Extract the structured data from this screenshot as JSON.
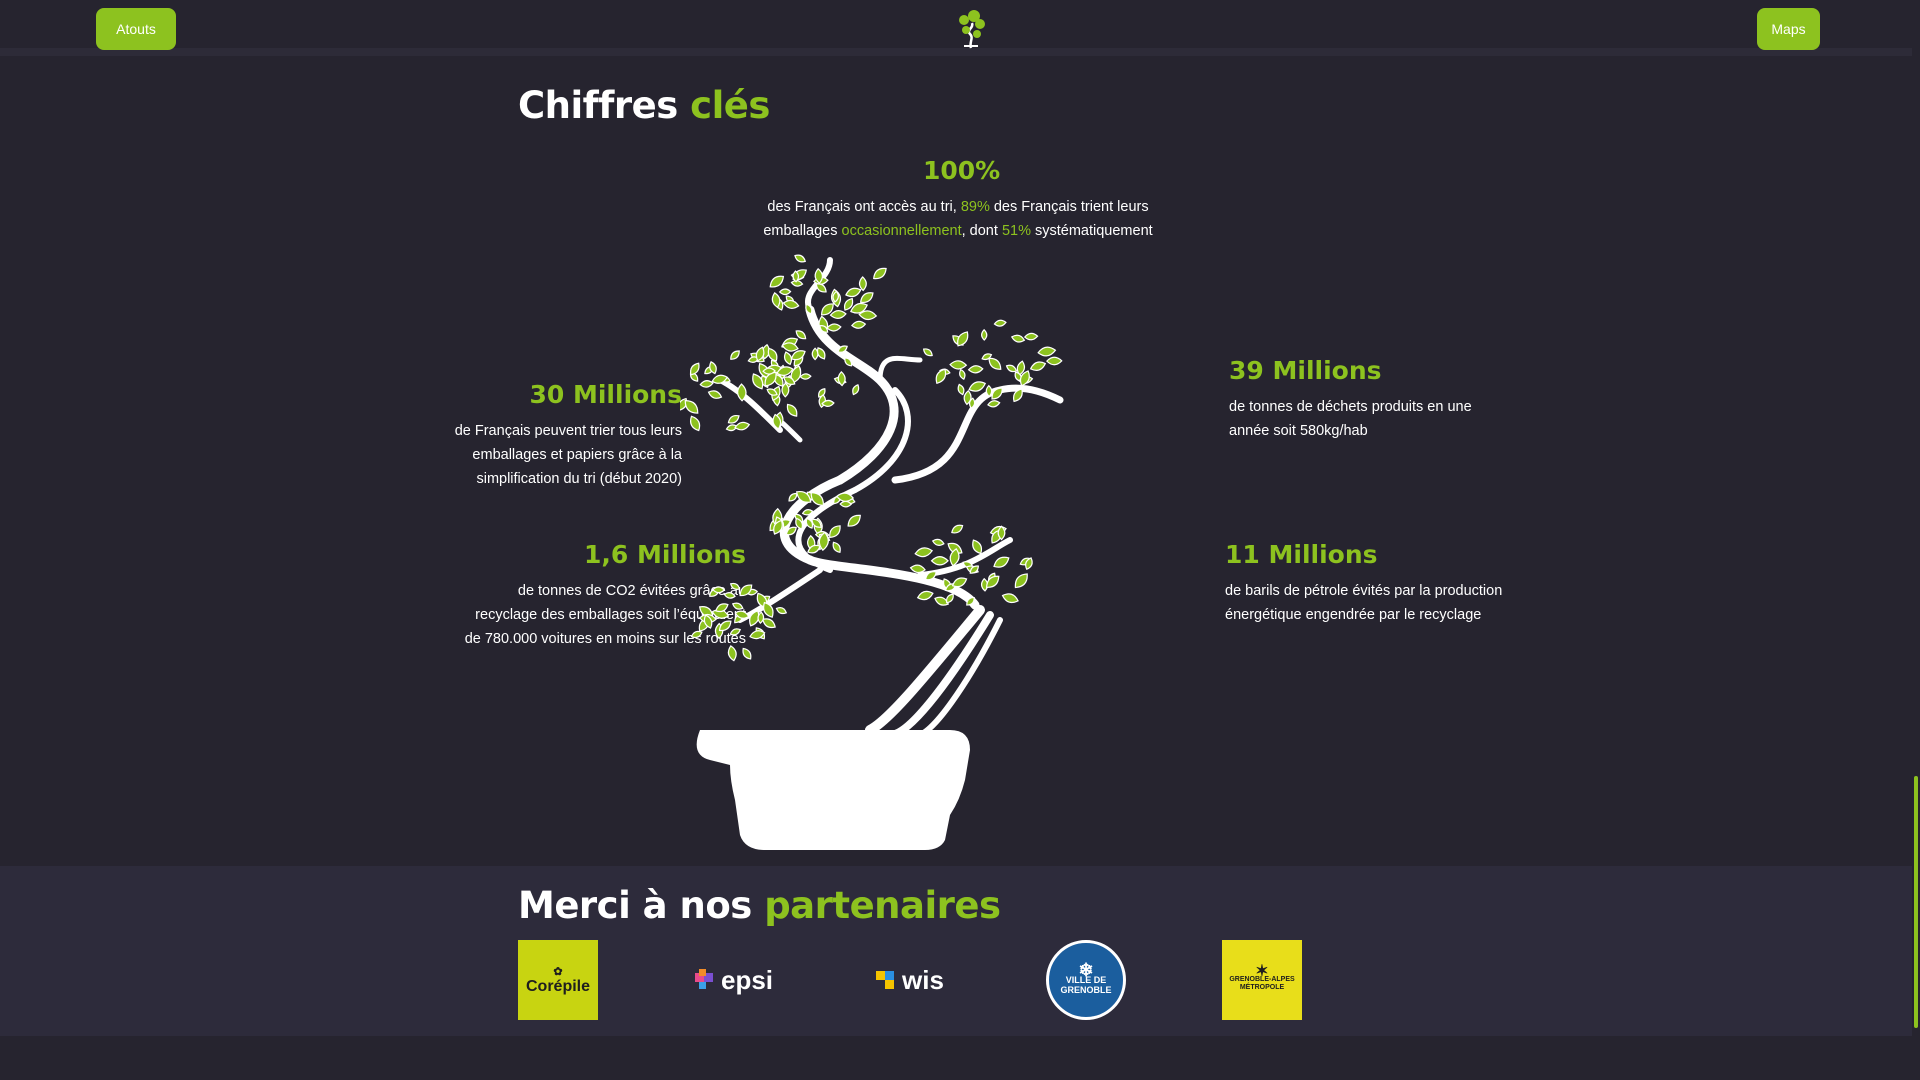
{
  "nav": {
    "left_button": "Atouts",
    "right_button": "Maps"
  },
  "key_figures": {
    "title_plain": "Chiffres",
    "title_accent": "clés",
    "stats": {
      "top": {
        "value": "100%",
        "text_1": "des Français ont accès au tri, ",
        "hl_1": "89%",
        "text_2": " des Français trient leurs",
        "text_3": "emballages ",
        "hl_2": "occasionnellement",
        "text_4": ", dont ",
        "hl_3": "51%",
        "text_5": " systématiquement"
      },
      "left_upper": {
        "value": "30 Millions",
        "text": "de Français peuvent trier tous leurs emballages et papiers grâce à la simplification du tri (début 2020)"
      },
      "left_lower": {
        "value": "1,6 Millions",
        "text": "de tonnes de CO2 évitées grâce au recyclage des emballages soit l’équivalent de 780.000 voitures en moins sur les routes"
      },
      "right_upper": {
        "value": "39 Millions",
        "text": "de tonnes de déchets produits en une année soit 580kg/hab"
      },
      "right_lower": {
        "value": "11 Millions",
        "text": "de barils de pétrole évités par la production énergétique engendrée par le recyclage"
      }
    }
  },
  "partners": {
    "title_plain": "Merci à nos",
    "title_accent": "partenaires",
    "items": [
      {
        "name": "Corépile"
      },
      {
        "name": "epsi"
      },
      {
        "name": "wis"
      },
      {
        "name": "VILLE DE GRENOBLE"
      },
      {
        "name": "GRENOBLE-ALPES MÉTROPOLE"
      }
    ]
  },
  "colors": {
    "accent": "#8dc21f",
    "background": "#26242f",
    "band": "#2d2b3b"
  },
  "icons": [
    "bonsai-logo-icon",
    "bonsai-tree-illustration"
  ]
}
